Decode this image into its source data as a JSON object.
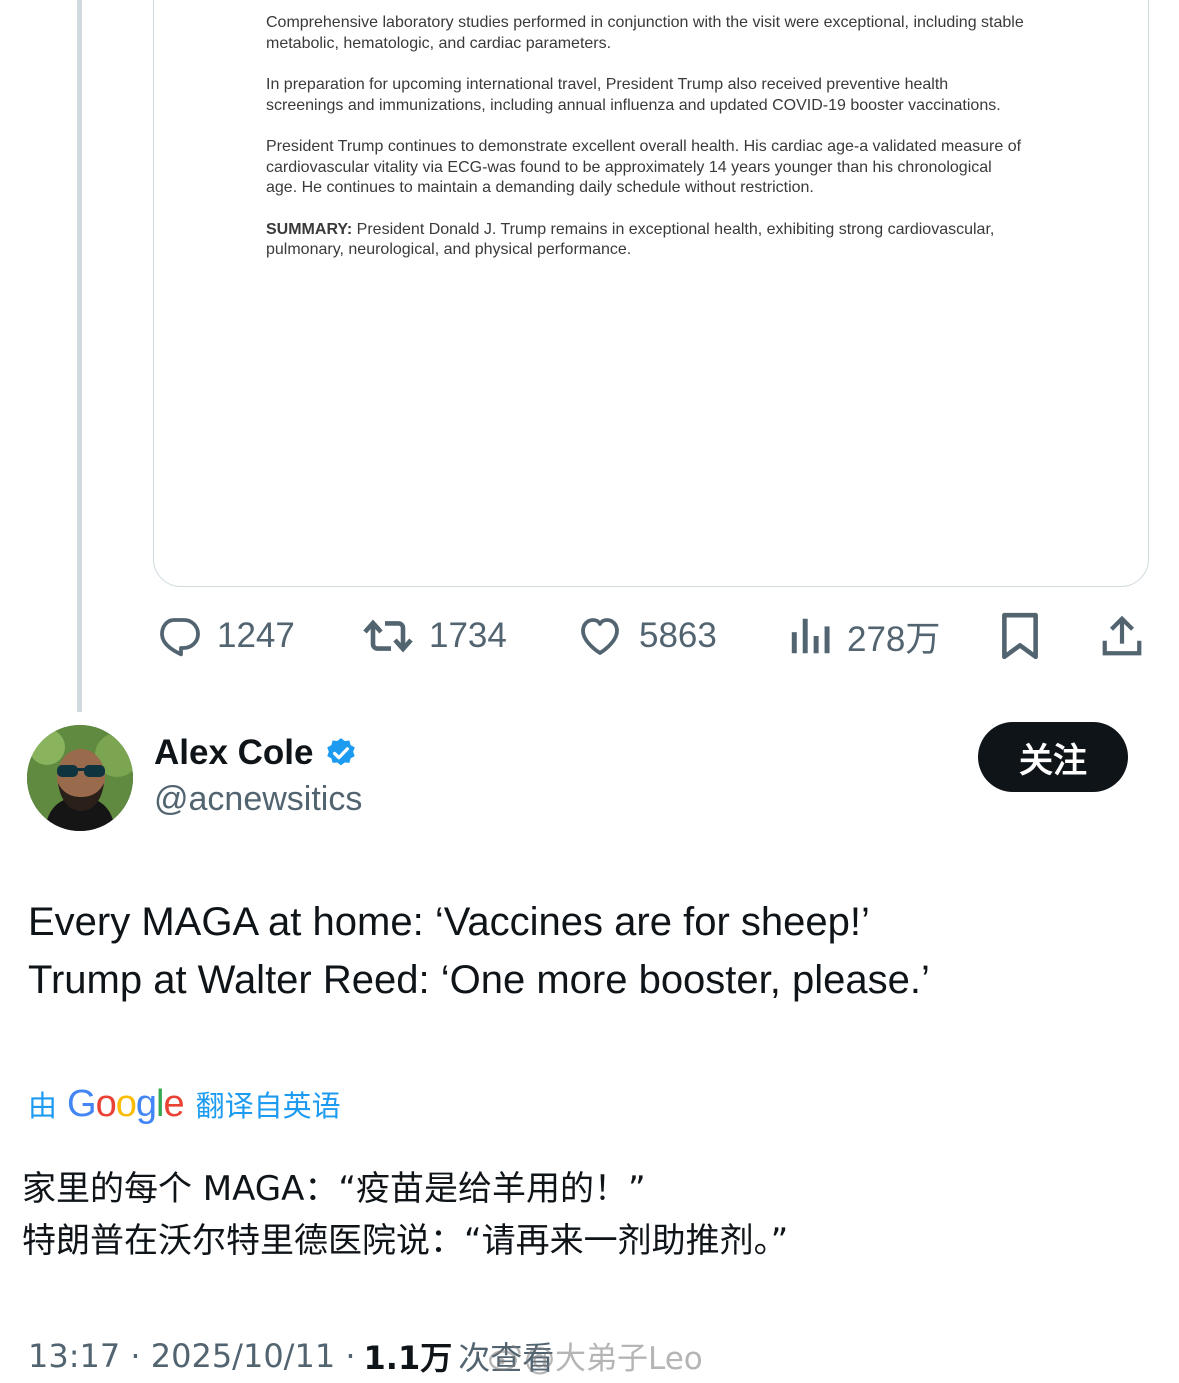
{
  "document": {
    "paragraphs": [
      "Comprehensive laboratory studies performed in conjunction with the visit were exceptional, including stable metabolic, hematologic, and cardiac parameters.",
      "In preparation for upcoming international travel, President Trump also received preventive health screenings and immunizations, including annual influenza and updated COVID-19 booster vaccinations.",
      "President Trump continues to demonstrate excellent overall health. His cardiac age-a validated measure of cardiovascular vitality via ECG-was found to be approximately 14 years younger than his chronological age. He continues to maintain a demanding daily schedule without restriction."
    ],
    "summary_label": "SUMMARY:",
    "summary_text": " President Donald J. Trump remains in exceptional health, exhibiting strong cardiovascular, pulmonary, neurological, and physical performance."
  },
  "actions": {
    "replies": "1247",
    "retweets": "1734",
    "likes": "5863",
    "views": "278万"
  },
  "author": {
    "name": "Alex Cole",
    "handle": "@acnewsitics",
    "follow_label": "关注"
  },
  "tweet": {
    "line1": "Every MAGA at home: ‘Vaccines are for sheep!’",
    "line2": "Trump at Walter Reed: ‘One more booster, please.’"
  },
  "translation": {
    "by": "由",
    "from": "翻译自英语",
    "line1": "家里的每个 MAGA：“疫苗是给羊用的！”",
    "line2": "特朗普在沃尔特里德医院说：“请再来一剂助推剂。”"
  },
  "meta": {
    "time_date": "13:17 · 2025/10/11 · ",
    "views_count": "1.1万",
    "views_label": "次查看"
  },
  "watermark": "@大弟子Leo",
  "colors": {
    "accent": "#1d9bf0",
    "secondary_text": "#536471",
    "follow_bg": "#0f1419"
  }
}
